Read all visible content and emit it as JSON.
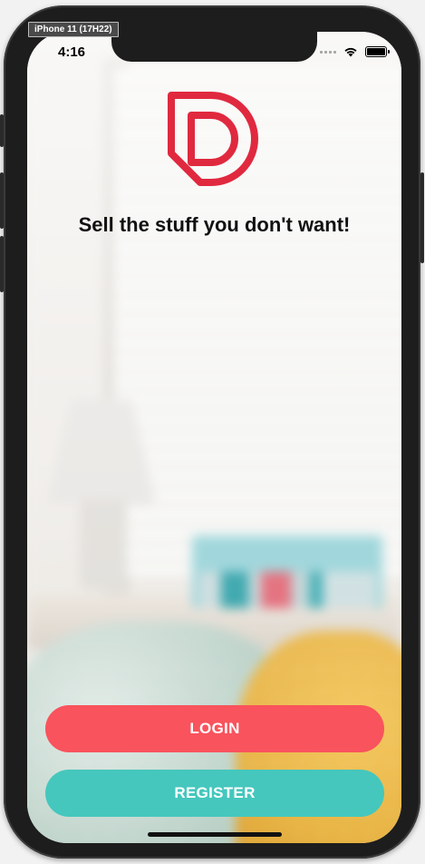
{
  "simulator": {
    "label": "iPhone 11 (17H22)"
  },
  "status_bar": {
    "time": "4:16",
    "icons": [
      "signal-icon",
      "wifi-icon",
      "battery-icon"
    ]
  },
  "app": {
    "logo": {
      "icon": "brand-d-logo-icon",
      "color": "#e0293f"
    },
    "tagline": "Sell the stuff you don't want!",
    "buttons": {
      "login_label": "LOGIN",
      "register_label": "REGISTER"
    }
  },
  "colors": {
    "login": "#f9535d",
    "register": "#45c7bd"
  }
}
